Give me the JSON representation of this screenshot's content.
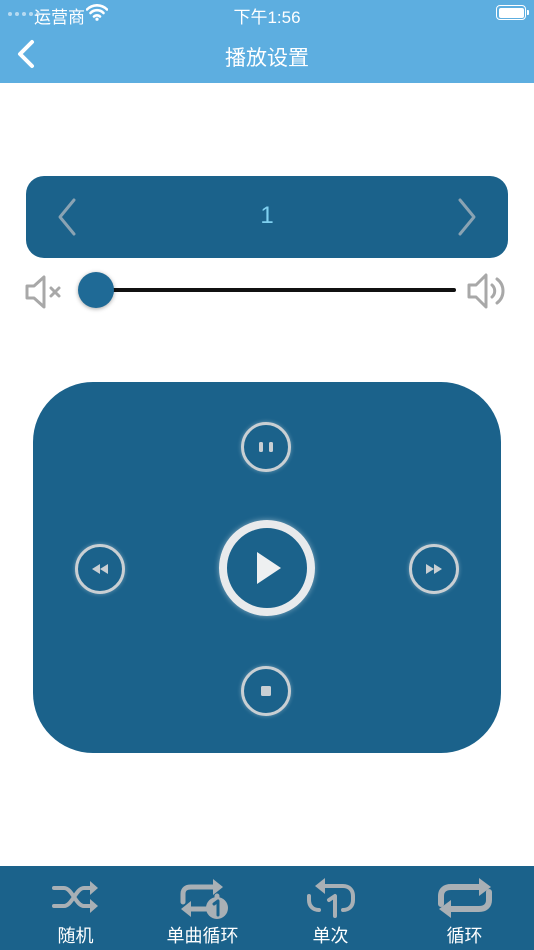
{
  "status_bar": {
    "carrier": "运营商",
    "time": "下午1:56"
  },
  "nav": {
    "title": "播放设置",
    "back_icon": "chevron-left-icon"
  },
  "selector": {
    "value": "1",
    "prev_icon": "chevron-left-icon",
    "next_icon": "chevron-right-icon"
  },
  "volume": {
    "level": 0,
    "mute_icon": "speaker-mute-icon",
    "max_icon": "speaker-loud-icon"
  },
  "controls": {
    "pause_icon": "pause-icon",
    "rewind_icon": "rewind-icon",
    "play_icon": "play-icon",
    "fast_forward_icon": "fast-forward-icon",
    "stop_icon": "stop-icon"
  },
  "tabs": [
    {
      "label": "随机",
      "icon": "shuffle-icon"
    },
    {
      "label": "单曲循环",
      "icon": "repeat-one-icon"
    },
    {
      "label": "单次",
      "icon": "play-once-icon"
    },
    {
      "label": "循环",
      "icon": "repeat-icon"
    }
  ],
  "colors": {
    "header": "#5daee0",
    "panel": "#1b628b",
    "value_text": "#7fd0f0"
  }
}
